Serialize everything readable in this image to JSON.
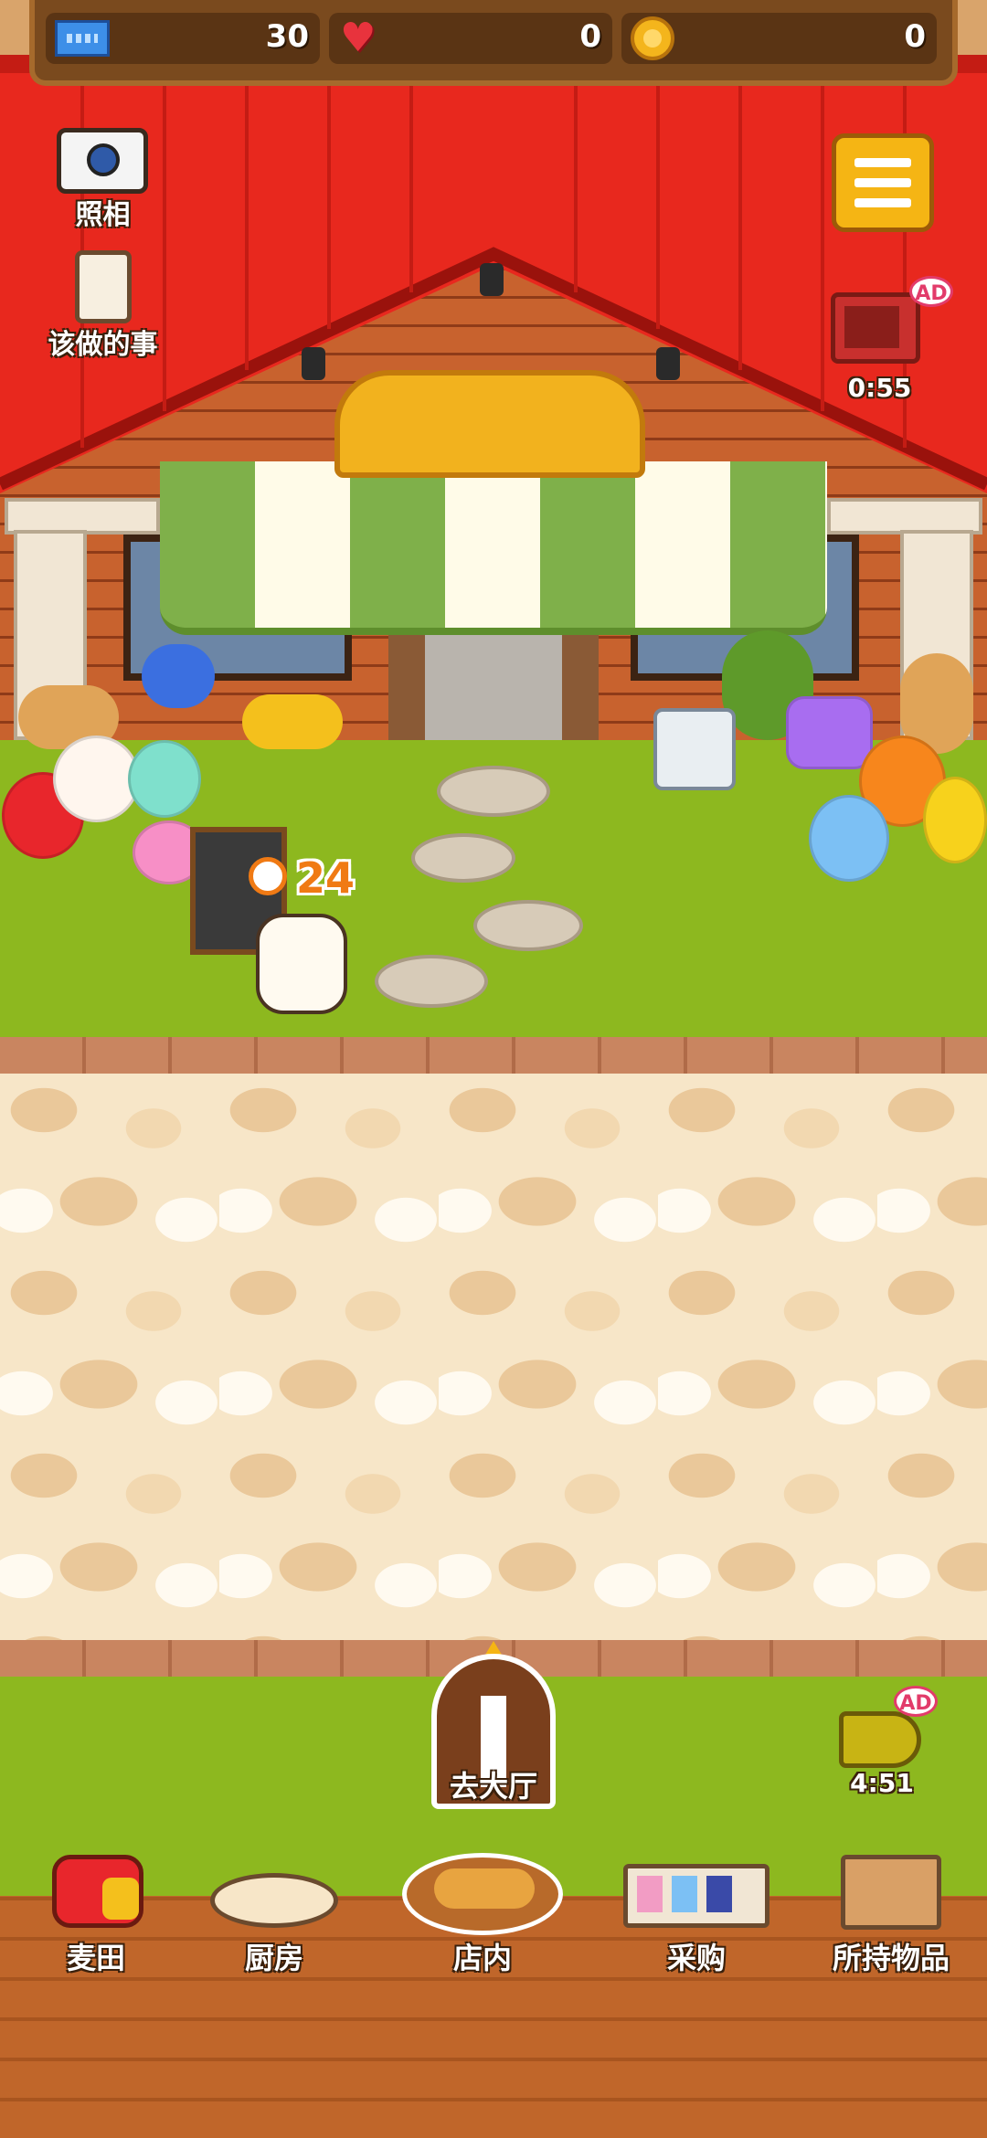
{
  "hud": {
    "tickets": "30",
    "hearts": "0",
    "coins": "0"
  },
  "side_left": {
    "photo_label": "照相",
    "todo_label": "该做的事"
  },
  "side_right": {
    "menu_icon": "hamburger-menu-icon",
    "tv_ad_badge": "AD",
    "tv_ad_timer": "0:55",
    "horn_ad_badge": "AD",
    "horn_ad_timer": "4:51"
  },
  "scene": {
    "cat_timer": "24",
    "go_hall_label": "去大厅"
  },
  "nav": {
    "items": [
      {
        "label": "麦田",
        "icon": "wheat-field-icon"
      },
      {
        "label": "厨房",
        "icon": "kitchen-dough-icon"
      },
      {
        "label": "店内",
        "icon": "bread-basket-icon"
      },
      {
        "label": "采购",
        "icon": "shop-shelf-icon"
      },
      {
        "label": "所持物品",
        "icon": "inventory-box-icon"
      }
    ]
  },
  "colors": {
    "roof": "#e8281e",
    "grass": "#8db81f",
    "hud_bg": "#7a4a1e",
    "accent_yellow": "#f5b514"
  }
}
